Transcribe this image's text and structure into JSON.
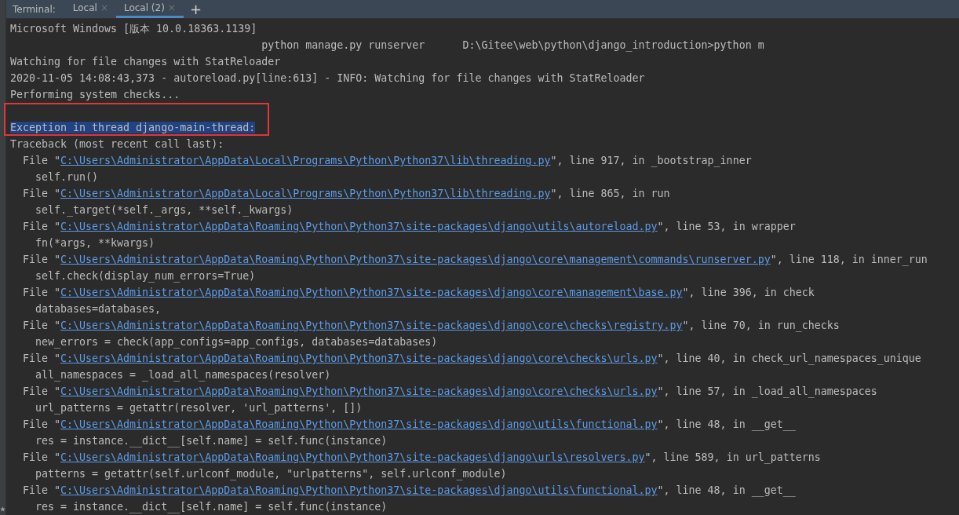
{
  "tab_bar": {
    "label": "Terminal:",
    "tabs": [
      {
        "label": "Local",
        "close": "×",
        "selected": false
      },
      {
        "label": "Local (2)",
        "close": "×",
        "selected": true
      }
    ],
    "add": "+"
  },
  "terminal": {
    "lines": [
      {
        "kind": "text",
        "text": "Microsoft Windows [版本 10.0.18363.1139]"
      },
      {
        "kind": "text",
        "text": "                                        python manage.py runserver      D:\\Gitee\\web\\python\\django_introduction>python m"
      },
      {
        "kind": "text",
        "text": "Watching for file changes with StatReloader"
      },
      {
        "kind": "text",
        "text": "2020-11-05 14:08:43,373 - autoreload.py[line:613] - INFO: Watching for file changes with StatReloader"
      },
      {
        "kind": "text",
        "text": "Performing system checks..."
      },
      {
        "kind": "marked",
        "text": "Exception in thread django-main-thread:"
      },
      {
        "kind": "text",
        "text": "Traceback (most recent call last):"
      },
      {
        "kind": "file",
        "prefix": "  File \"",
        "path": "C:\\Users\\Administrator\\AppData\\Local\\Programs\\Python\\Python37\\lib\\threading.py",
        "suffix": "\", line 917, in _bootstrap_inner"
      },
      {
        "kind": "text",
        "text": "    self.run()"
      },
      {
        "kind": "file",
        "prefix": "  File \"",
        "path": "C:\\Users\\Administrator\\AppData\\Local\\Programs\\Python\\Python37\\lib\\threading.py",
        "suffix": "\", line 865, in run"
      },
      {
        "kind": "text",
        "text": "    self._target(*self._args, **self._kwargs)"
      },
      {
        "kind": "file",
        "prefix": "  File \"",
        "path": "C:\\Users\\Administrator\\AppData\\Roaming\\Python\\Python37\\site-packages\\django\\utils\\autoreload.py",
        "suffix": "\", line 53, in wrapper"
      },
      {
        "kind": "text",
        "text": "    fn(*args, **kwargs)"
      },
      {
        "kind": "file",
        "prefix": "  File \"",
        "path": "C:\\Users\\Administrator\\AppData\\Roaming\\Python\\Python37\\site-packages\\django\\core\\management\\commands\\runserver.py",
        "suffix": "\", line 118, in inner_run"
      },
      {
        "kind": "text",
        "text": "    self.check(display_num_errors=True)"
      },
      {
        "kind": "file",
        "prefix": "  File \"",
        "path": "C:\\Users\\Administrator\\AppData\\Roaming\\Python\\Python37\\site-packages\\django\\core\\management\\base.py",
        "suffix": "\", line 396, in check"
      },
      {
        "kind": "text",
        "text": "    databases=databases,"
      },
      {
        "kind": "file",
        "prefix": "  File \"",
        "path": "C:\\Users\\Administrator\\AppData\\Roaming\\Python\\Python37\\site-packages\\django\\core\\checks\\registry.py",
        "suffix": "\", line 70, in run_checks"
      },
      {
        "kind": "text",
        "text": "    new_errors = check(app_configs=app_configs, databases=databases)"
      },
      {
        "kind": "file",
        "prefix": "  File \"",
        "path": "C:\\Users\\Administrator\\AppData\\Roaming\\Python\\Python37\\site-packages\\django\\core\\checks\\urls.py",
        "suffix": "\", line 40, in check_url_namespaces_unique"
      },
      {
        "kind": "text",
        "text": "    all_namespaces = _load_all_namespaces(resolver)"
      },
      {
        "kind": "file",
        "prefix": "  File \"",
        "path": "C:\\Users\\Administrator\\AppData\\Roaming\\Python\\Python37\\site-packages\\django\\core\\checks\\urls.py",
        "suffix": "\", line 57, in _load_all_namespaces"
      },
      {
        "kind": "text",
        "text": "    url_patterns = getattr(resolver, 'url_patterns', [])"
      },
      {
        "kind": "file",
        "prefix": "  File \"",
        "path": "C:\\Users\\Administrator\\AppData\\Roaming\\Python\\Python37\\site-packages\\django\\utils\\functional.py",
        "suffix": "\", line 48, in __get__"
      },
      {
        "kind": "text",
        "text": "    res = instance.__dict__[self.name] = self.func(instance)"
      },
      {
        "kind": "file",
        "prefix": "  File \"",
        "path": "C:\\Users\\Administrator\\AppData\\Roaming\\Python\\Python37\\site-packages\\django\\urls\\resolvers.py",
        "suffix": "\", line 589, in url_patterns"
      },
      {
        "kind": "text",
        "text": "    patterns = getattr(self.urlconf_module, \"urlpatterns\", self.urlconf_module)"
      },
      {
        "kind": "file",
        "prefix": "  File \"",
        "path": "C:\\Users\\Administrator\\AppData\\Roaming\\Python\\Python37\\site-packages\\django\\utils\\functional.py",
        "suffix": "\", line 48, in __get__"
      },
      {
        "kind": "text",
        "text": "    res = instance.__dict__[self.name] = self.func(instance)"
      }
    ]
  }
}
